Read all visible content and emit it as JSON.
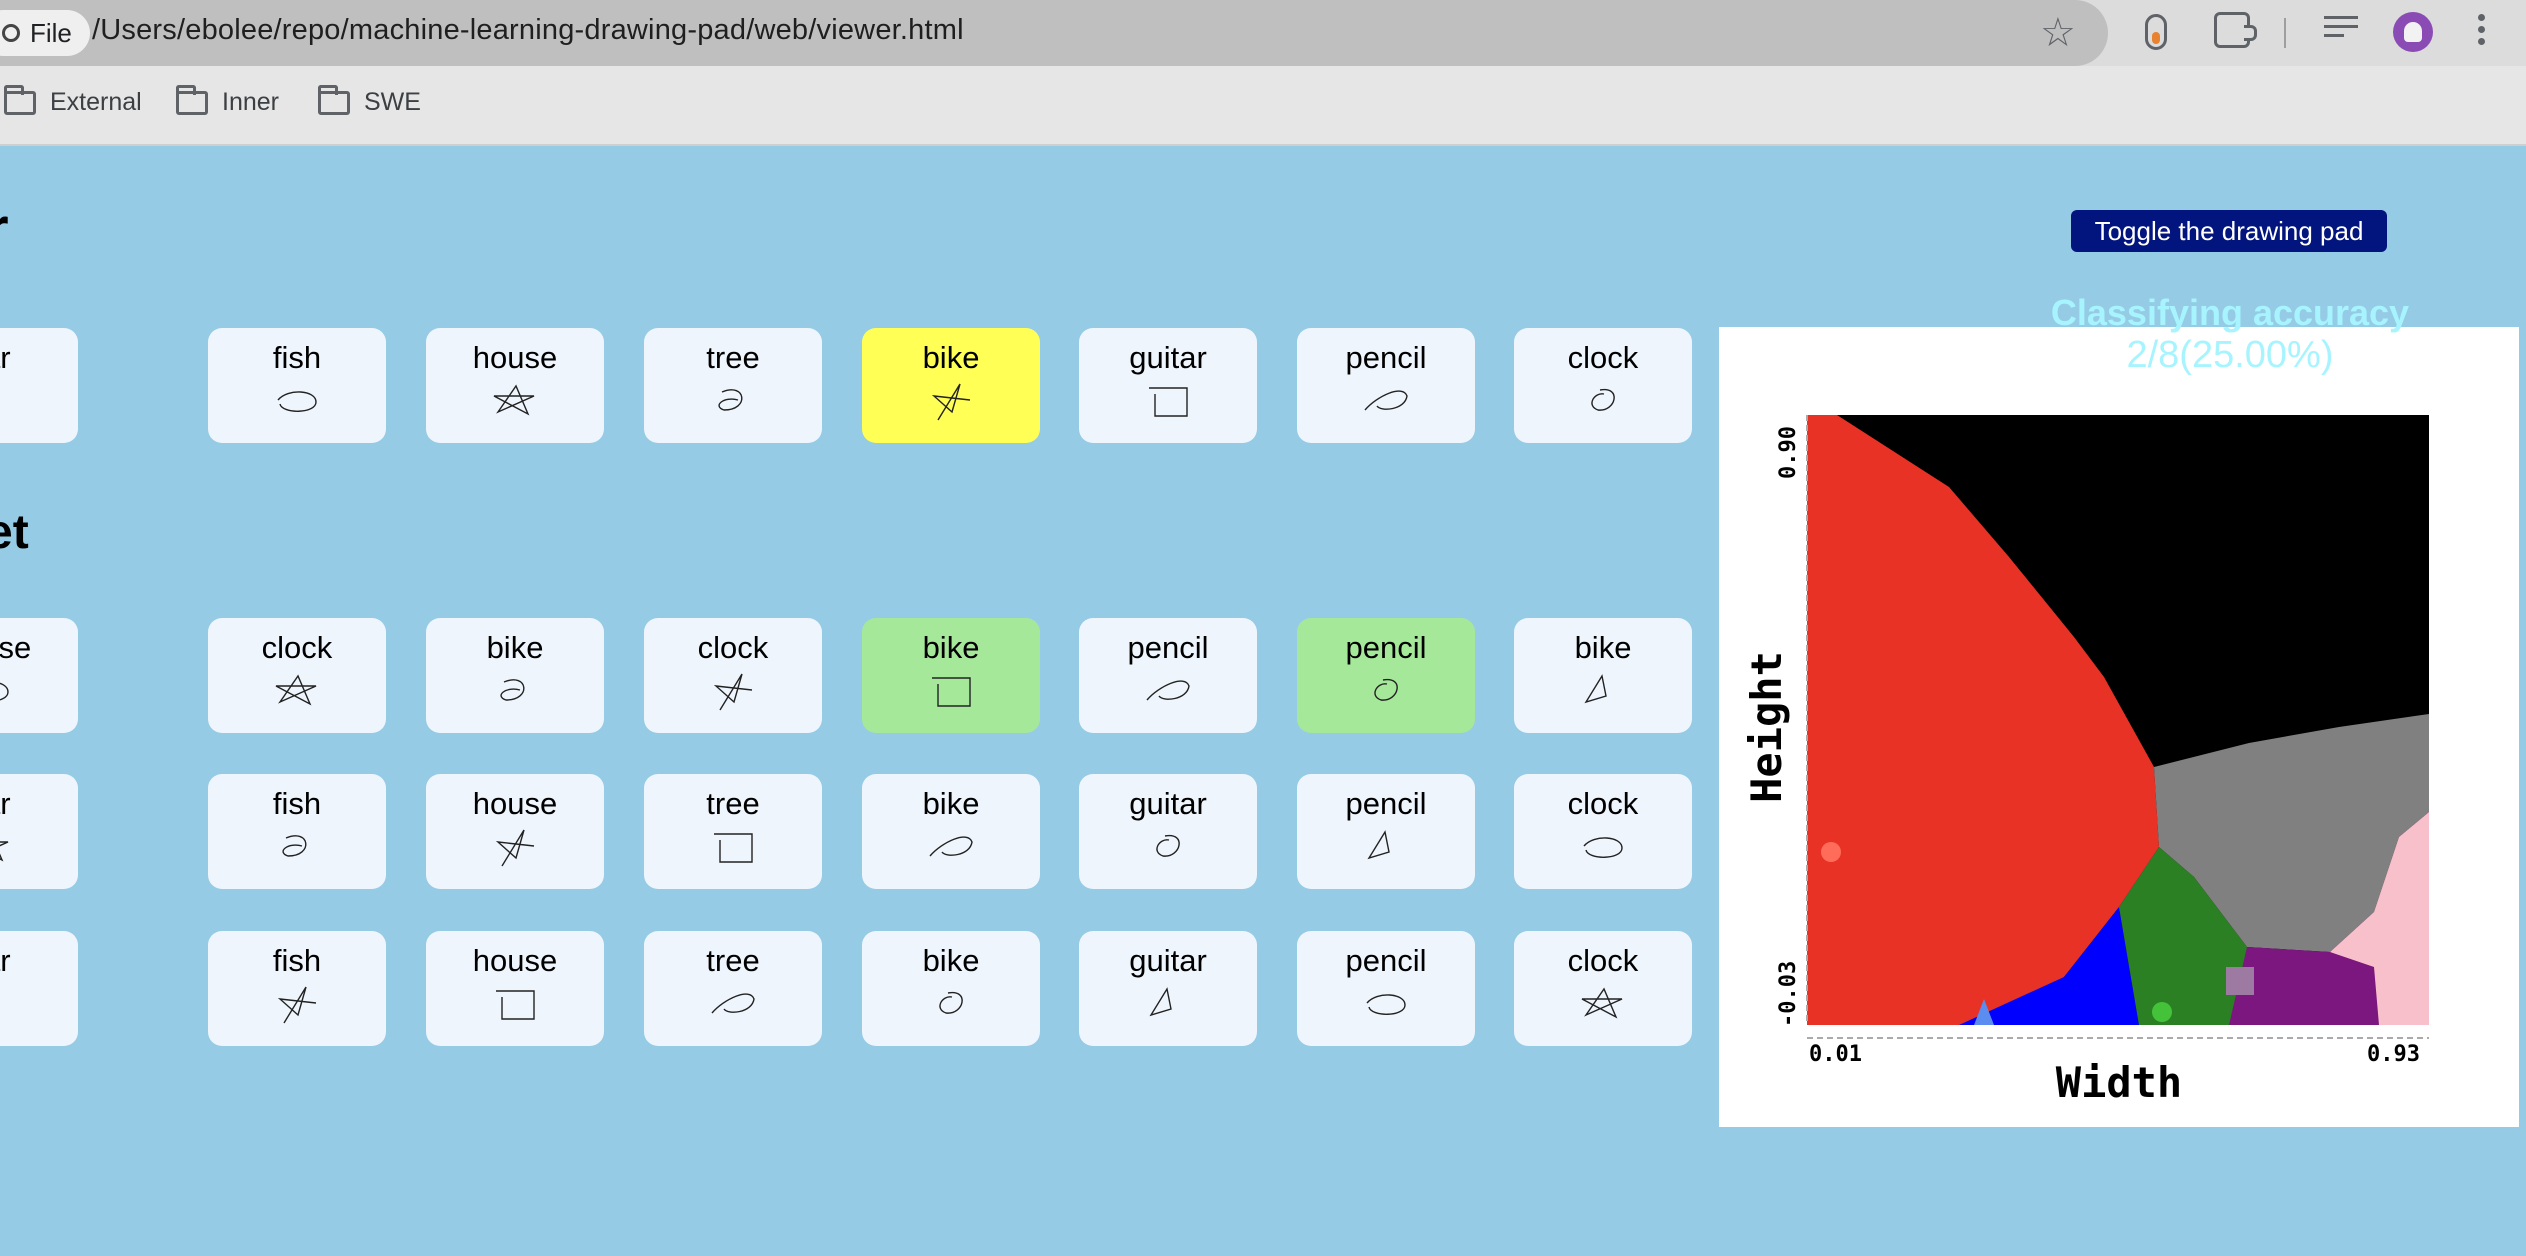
{
  "browser": {
    "file_chip": "File",
    "url": "/Users/ebolee/repo/machine-learning-drawing-pad/web/viewer.html",
    "bookmarks": [
      "External",
      "Inner",
      "SWE"
    ]
  },
  "page": {
    "heading_top": "r",
    "heading_mid": "et",
    "toggle_label": "Toggle the drawing pad",
    "accuracy_title": "Classifying accuracy",
    "accuracy_value": "2/8(25.00%)"
  },
  "rows": [
    [
      "car",
      "fish",
      "house",
      "tree",
      "bike",
      "guitar",
      "pencil",
      "clock"
    ],
    [
      "house",
      "clock",
      "bike",
      "clock",
      "bike",
      "pencil",
      "pencil",
      "bike"
    ],
    [
      "car",
      "fish",
      "house",
      "tree",
      "bike",
      "guitar",
      "pencil",
      "clock"
    ],
    [
      "car",
      "fish",
      "house",
      "tree",
      "bike",
      "guitar",
      "pencil",
      "clock"
    ]
  ],
  "highlights": {
    "yellow": [
      [
        0,
        4
      ]
    ],
    "green": [
      [
        1,
        4
      ],
      [
        1,
        6
      ]
    ]
  },
  "chart": {
    "xlabel": "Width",
    "ylabel": "Height",
    "x_min_label": "0.01",
    "x_max_label": "0.93",
    "y_min_label": "-0.03",
    "y_max_label": "0.90",
    "region_colors": {
      "car": "#e83226",
      "empty": "#000000",
      "gray": "#808080",
      "purple": "#7b177e",
      "pink": "#f7c0cb",
      "blue": "#0000fe",
      "green": "#2b8023"
    }
  }
}
